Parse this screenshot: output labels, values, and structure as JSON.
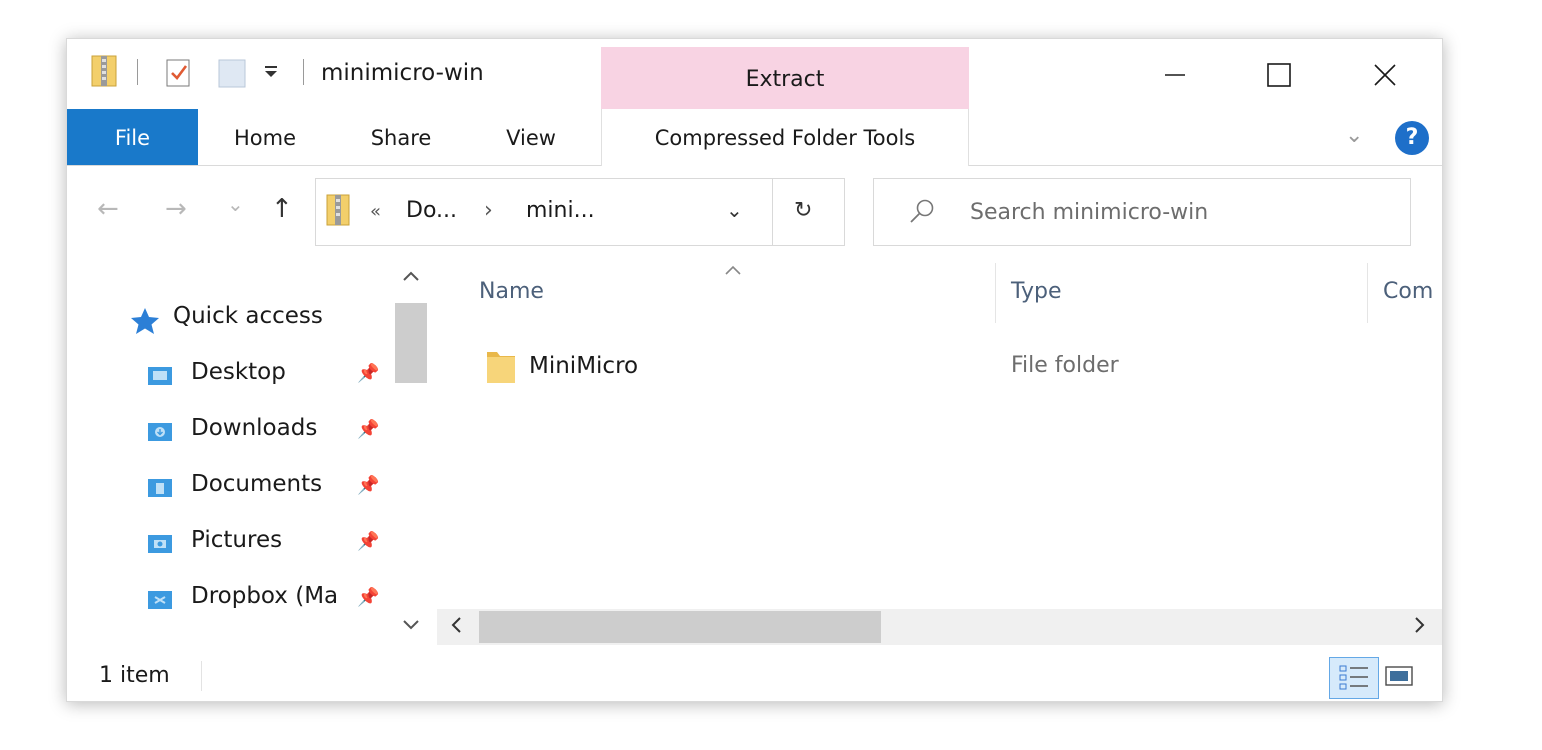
{
  "window": {
    "title": "minimicro-win",
    "context_tab_group": "Extract",
    "minimize_glyph": "—",
    "maximize_glyph": "☐",
    "close_glyph": "✕"
  },
  "ribbon": {
    "tabs": [
      {
        "label": "File"
      },
      {
        "label": "Home"
      },
      {
        "label": "Share"
      },
      {
        "label": "View"
      },
      {
        "label": "Compressed Folder Tools"
      }
    ],
    "expand_glyph": "⌄",
    "help_glyph": "?"
  },
  "navigation": {
    "back_glyph": "←",
    "forward_glyph": "→",
    "recent_glyph": "⌄",
    "up_glyph": "↑",
    "address": {
      "overflow_glyph": "«",
      "crumbs": [
        "Do...",
        "mini..."
      ],
      "separator": "›",
      "dropdown_glyph": "⌄",
      "refresh_glyph": "↻"
    },
    "search": {
      "placeholder": "Search minimicro-win",
      "value": ""
    }
  },
  "nav_pane": {
    "quick_access": "Quick access",
    "items": [
      {
        "label": "Desktop",
        "icon": "desktop-icon",
        "pinned": true
      },
      {
        "label": "Downloads",
        "icon": "downloads-icon",
        "pinned": true
      },
      {
        "label": "Documents",
        "icon": "documents-icon",
        "pinned": true
      },
      {
        "label": "Pictures",
        "icon": "pictures-icon",
        "pinned": true
      },
      {
        "label": "Dropbox (Ma",
        "icon": "dropbox-icon",
        "pinned": true
      }
    ]
  },
  "file_list": {
    "columns": [
      "Name",
      "Type",
      "Com"
    ],
    "sort_glyph": "^",
    "rows": [
      {
        "name": "MiniMicro",
        "type": "File folder"
      }
    ],
    "scroll_left_glyph": "<",
    "scroll_right_glyph": ">"
  },
  "status": {
    "item_count": "1 item"
  },
  "colors": {
    "accent": "#1979ca",
    "context_tab": "#f8d3e3",
    "folder": "#f7d57a",
    "help": "#1e6fc9"
  }
}
